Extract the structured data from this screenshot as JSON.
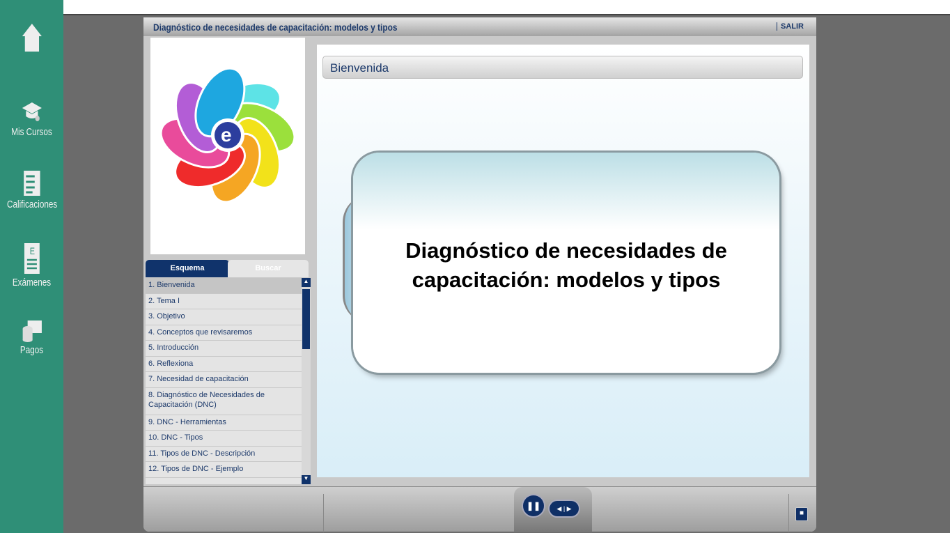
{
  "sidebar": {
    "items": [
      {
        "label": "",
        "icon": "home-icon"
      },
      {
        "label": "Mis Cursos",
        "icon": "graduation-cap-icon"
      },
      {
        "label": "Calificaciones",
        "icon": "checklist-icon"
      },
      {
        "label": "Exámenes",
        "icon": "exam-icon"
      },
      {
        "label": "Pagos",
        "icon": "payments-icon"
      }
    ]
  },
  "player": {
    "title": "Diagnóstico de necesidades de capacitación: modelos y tipos",
    "exit_label": "SALIR",
    "tabs": [
      {
        "label": "Esquema",
        "active": true
      },
      {
        "label": "Buscar",
        "active": false
      }
    ],
    "outline": [
      "1. Bienvenida",
      "2. Tema I",
      "3. Objetivo",
      "4. Conceptos que revisaremos",
      "5. Introducción",
      "6. Reflexiona",
      "7. Necesidad de capacitación",
      "8. Diagnóstico de Necesidades de Capacitación (DNC)",
      "9. DNC - Herramientas",
      "10. DNC - Tipos",
      "11. Tipos de DNC - Descripción",
      "12. Tipos de DNC - Ejemplo"
    ],
    "slide": {
      "header": "Bienvenida",
      "title_line1": "Diagnóstico de necesidades de",
      "title_line2": "capacitación: modelos y tipos"
    },
    "colors": {
      "accent": "#1d3a6b",
      "sidebar": "#2f8f77"
    }
  }
}
